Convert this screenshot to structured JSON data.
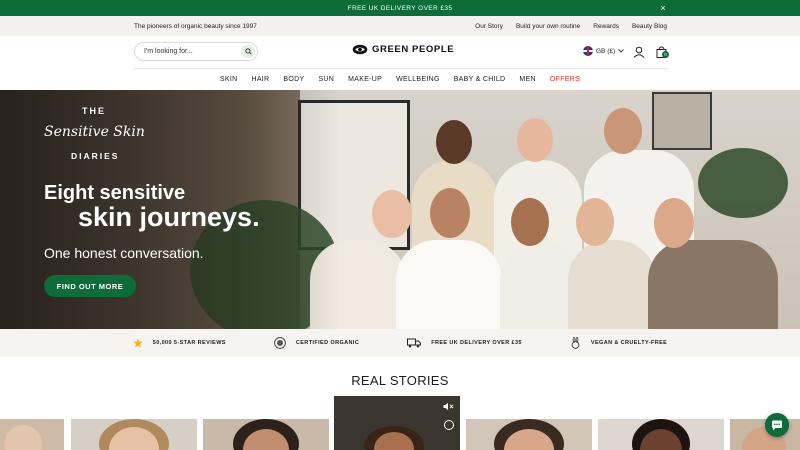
{
  "announcement": {
    "text": "FREE UK DELIVERY OVER £35",
    "close": "×"
  },
  "utility": {
    "tagline": "The pioneers of organic beauty since 1997",
    "links": [
      "Our Story",
      "Build your own routine",
      "Rewards",
      "Beauty Blog"
    ]
  },
  "search": {
    "placeholder": "I'm looking for..."
  },
  "logo": {
    "name": "GREEN PEOPLE"
  },
  "locale": {
    "label": "GB (£)"
  },
  "basket": {
    "count": "0"
  },
  "nav": {
    "items": [
      "SKIN",
      "HAIR",
      "BODY",
      "SUN",
      "MAKE-UP",
      "WELLBEING",
      "BABY & CHILD",
      "MEN",
      "OFFERS"
    ]
  },
  "hero": {
    "brand_the": "THE",
    "brand_script": "Sensitive Skin",
    "brand_diaries": "DIARIES",
    "headline_1": "Eight sensitive",
    "headline_2": "skin journeys.",
    "subhead": "One honest conversation.",
    "cta": "FIND OUT MORE"
  },
  "usps": [
    {
      "icon": "star-icon",
      "label": "50,000 5-STAR REVIEWS"
    },
    {
      "icon": "organic-badge-icon",
      "label": "CERTIFIED ORGANIC"
    },
    {
      "icon": "delivery-truck-icon",
      "label": "FREE UK DELIVERY OVER £35"
    },
    {
      "icon": "rabbit-icon",
      "label": "VEGAN & CRUELTY-FREE"
    }
  ],
  "section": {
    "title": "REAL STORIES"
  },
  "colors": {
    "brand_green": "#0e6b3a",
    "offers_red": "#d9342b",
    "usp_bg": "#f5f4f1"
  }
}
